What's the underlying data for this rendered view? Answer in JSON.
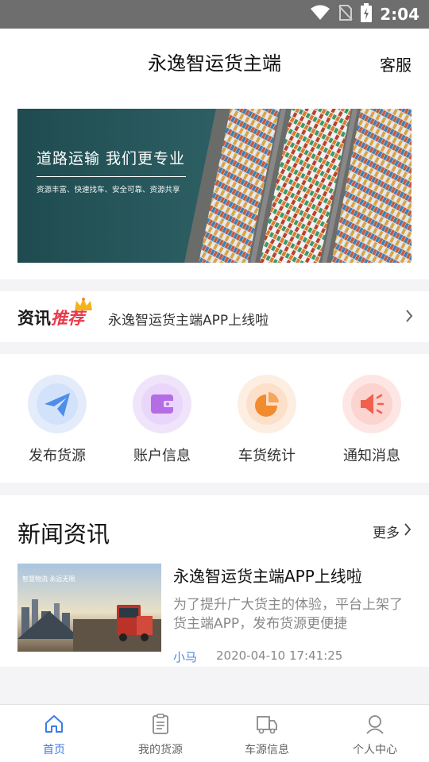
{
  "status_bar": {
    "time": "2:04"
  },
  "header": {
    "title": "永逸智运货主端",
    "service_label": "客服"
  },
  "banner": {
    "title": "道路运输   我们更专业",
    "subtitle": "资源丰富、快速找车、安全可靠、资源共享"
  },
  "ticker": {
    "label_a": "资讯",
    "label_b": "推荐",
    "text": "永逸智运货主端APP上线啦"
  },
  "quick_actions": [
    {
      "label": "发布货源",
      "icon": "send-icon"
    },
    {
      "label": "账户信息",
      "icon": "wallet-icon"
    },
    {
      "label": "车货统计",
      "icon": "pie-chart-icon"
    },
    {
      "label": "通知消息",
      "icon": "speaker-icon"
    }
  ],
  "news": {
    "heading": "新闻资讯",
    "more_label": "更多",
    "article": {
      "title": "永逸智运货主端APP上线啦",
      "summary": "为了提升广大货主的体验，平台上架了货主端APP，发布货源更便捷",
      "author": "小马",
      "time": "2020-04-10 17:41:25",
      "thumb_text": "智慧物流  永远无限"
    }
  },
  "tabs": [
    {
      "label": "首页",
      "icon": "home-icon",
      "active": true
    },
    {
      "label": "我的货源",
      "icon": "clipboard-icon",
      "active": false
    },
    {
      "label": "车源信息",
      "icon": "truck-icon",
      "active": false
    },
    {
      "label": "个人中心",
      "icon": "person-icon",
      "active": false
    }
  ],
  "colors": {
    "accent": "#3d7be6",
    "recommend_red": "#e93a4b",
    "background": "#f4f4f6"
  }
}
